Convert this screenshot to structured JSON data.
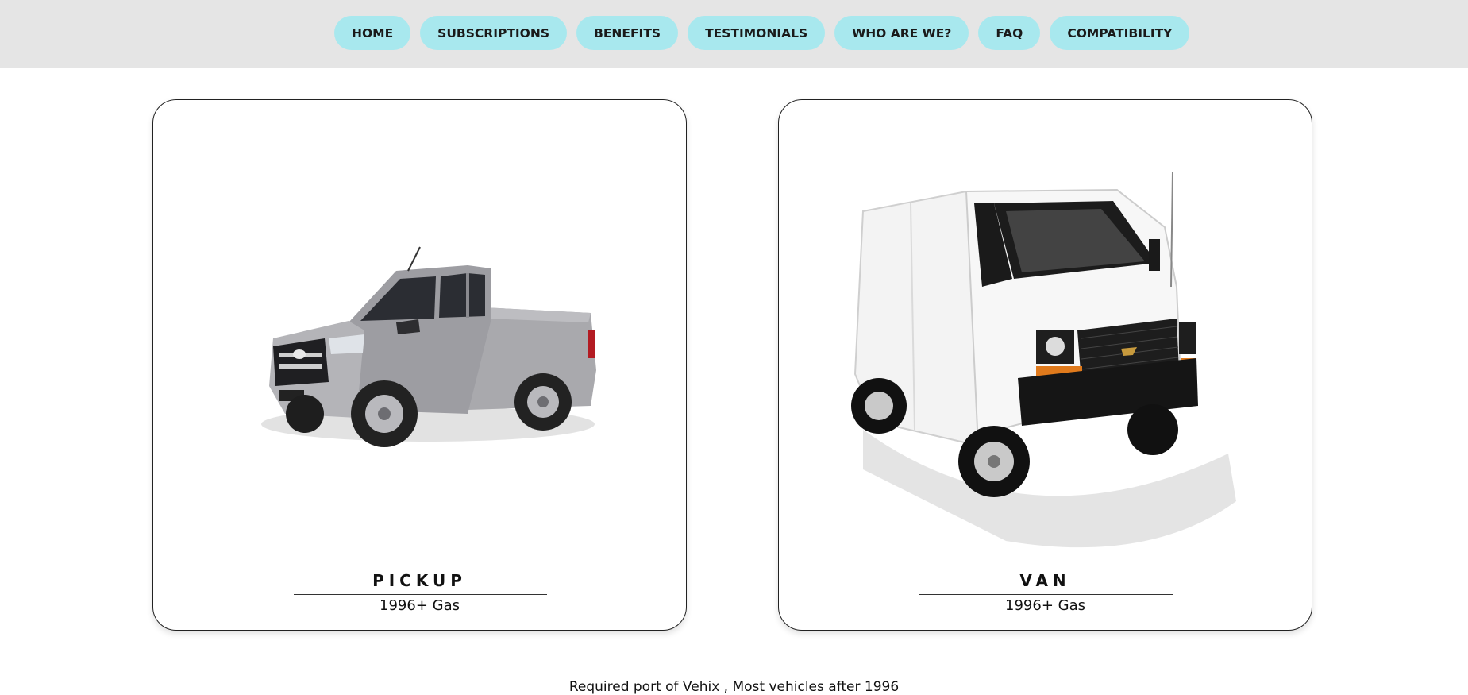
{
  "nav": {
    "items": [
      {
        "label": "HOME"
      },
      {
        "label": "SUBSCRIPTIONS"
      },
      {
        "label": "BENEFITS"
      },
      {
        "label": "TESTIMONIALS"
      },
      {
        "label": "WHO ARE WE?"
      },
      {
        "label": "FAQ"
      },
      {
        "label": "COMPATIBILITY"
      }
    ],
    "color": "#a8e8ee"
  },
  "cards": [
    {
      "title": "PICKUP",
      "subtitle": "1996+ Gas",
      "image_icon": "pickup-truck-image"
    },
    {
      "title": "VAN",
      "subtitle": "1996+ Gas",
      "image_icon": "cargo-van-image"
    }
  ],
  "footer": {
    "note": "Required port of Vehix , Most vehicles after 1996"
  },
  "colors": {
    "topbar": "#e5e5e5",
    "nav_button": "#a8e8ee"
  }
}
